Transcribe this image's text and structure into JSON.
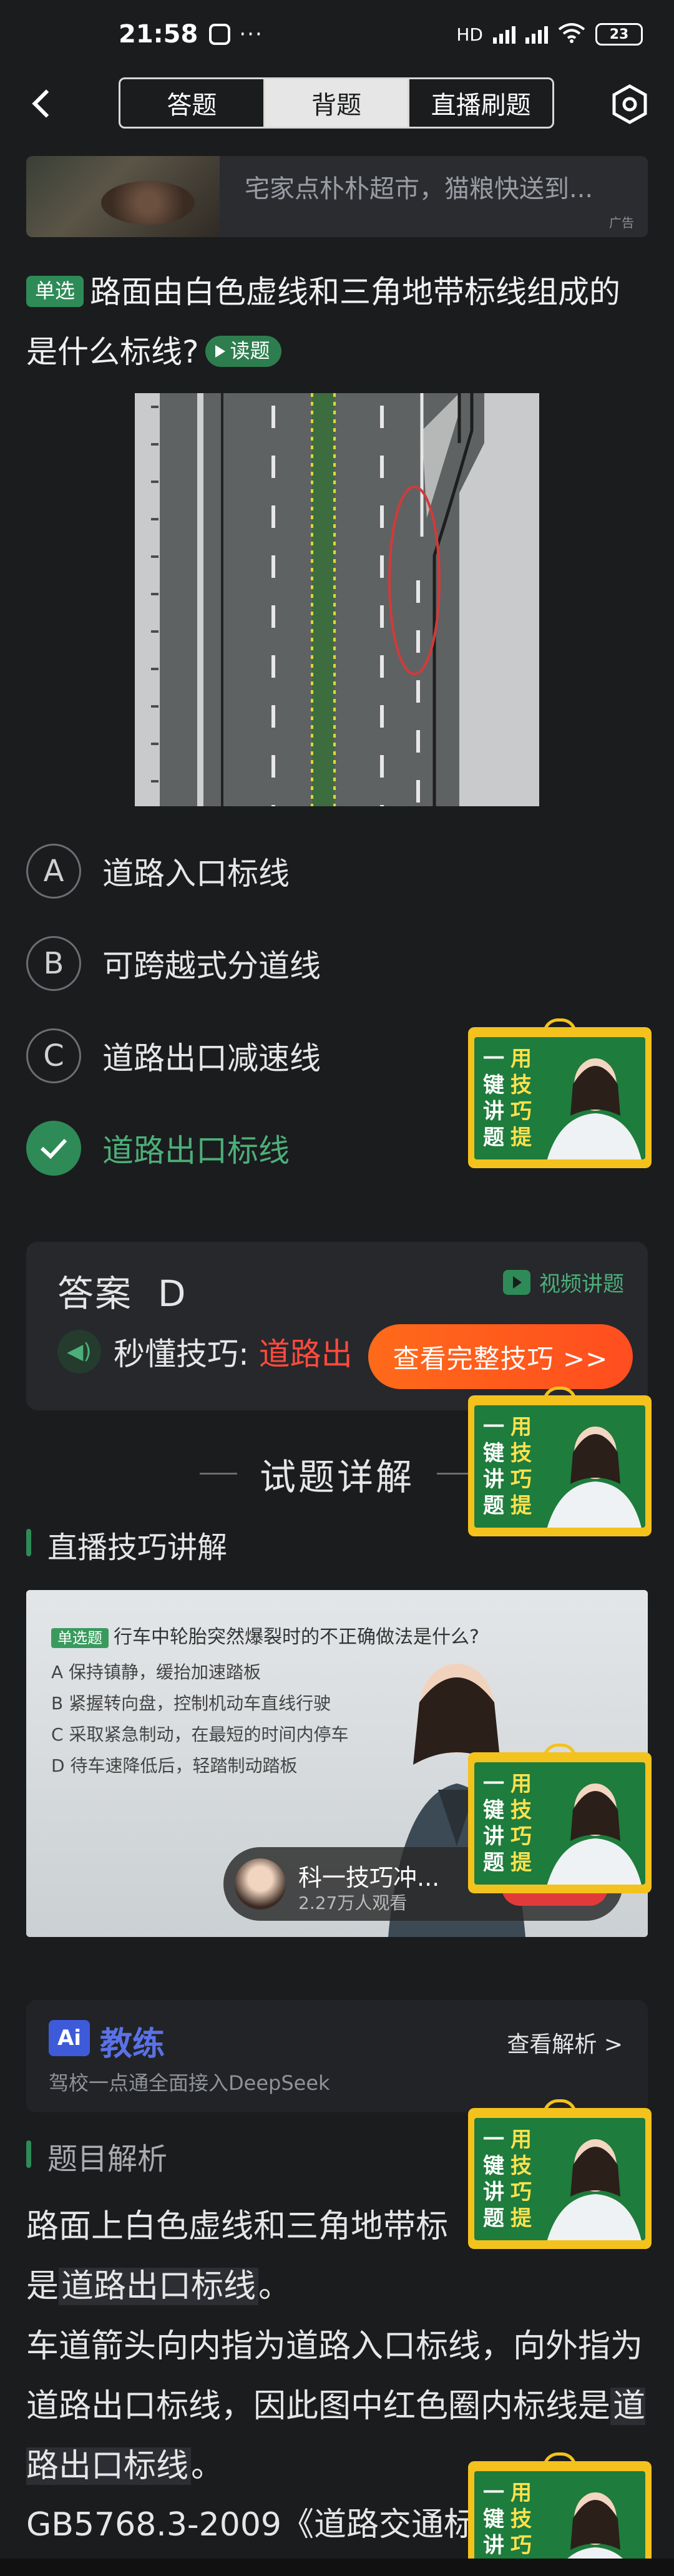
{
  "status": {
    "time": "21:58",
    "battery": "23",
    "network": "HD"
  },
  "header": {
    "tabs": [
      "答题",
      "背题",
      "直播刷题"
    ],
    "active_tab": "背题"
  },
  "ad": {
    "text": "宅家点朴朴超市，猫粮快送到...",
    "tag": "广告"
  },
  "question": {
    "type_badge": "单选",
    "text": "路面由白色虚线和三角地带标线组成的是什么标线?",
    "read_label": "读题"
  },
  "options": [
    {
      "letter": "A",
      "label": "道路入口标线",
      "correct": false
    },
    {
      "letter": "B",
      "label": "可跨越式分道线",
      "correct": false
    },
    {
      "letter": "C",
      "label": "道路出口减速线",
      "correct": false
    },
    {
      "letter": "D",
      "label": "道路出口标线",
      "correct": true
    }
  ],
  "answer": {
    "title": "答案",
    "letter": "D",
    "video_label": "视频讲题",
    "tip_prefix": "秒懂技巧:",
    "tip_red": "道路出",
    "cta": "查看完整技巧 >>"
  },
  "details": {
    "title": "试题详解",
    "live_title": "直播技巧讲解",
    "video": {
      "badge": "单选题",
      "question": "行车中轮胎突然爆裂时的不正确做法是什么?",
      "lines": [
        "A 保持镇静，缓抬加速踏板",
        "B 紧握转向盘，控制机动车直线行驶",
        "C 采取紧急制动，在最短的时间内停车",
        "D 待车速降低后，轻踏制动踏板"
      ],
      "host": "科一技巧冲...",
      "viewers": "2.27万人观看"
    }
  },
  "ai": {
    "logo": "Ai",
    "name": "教练",
    "desc": "驾校一点通全面接入DeepSeek",
    "link": "查看解析 >"
  },
  "analysis": {
    "title": "题目解析",
    "p1_a": "路面上白色虚线和三角地带标",
    "p1_b": "是",
    "p1_hl": "道路出口标线",
    "p1_c": "。",
    "p2_a": "车道箭头向内指为道路入口标线，向外指为道路出口标线，因此图中红色圈内标线是",
    "p2_hl": "道路出口标线",
    "p2_c": "。",
    "p3": "GB5768.3-2009《道路交通标"
  },
  "promo": {
    "col1": [
      "一",
      "键",
      "讲",
      "题"
    ],
    "col2": [
      "用",
      "技",
      "巧",
      "提"
    ]
  },
  "colors": {
    "accent_green": "#2e8b57",
    "cta_orange": "#ff5a1f",
    "tip_red": "#ff4a3d",
    "ai_blue": "#3d5bd9"
  }
}
